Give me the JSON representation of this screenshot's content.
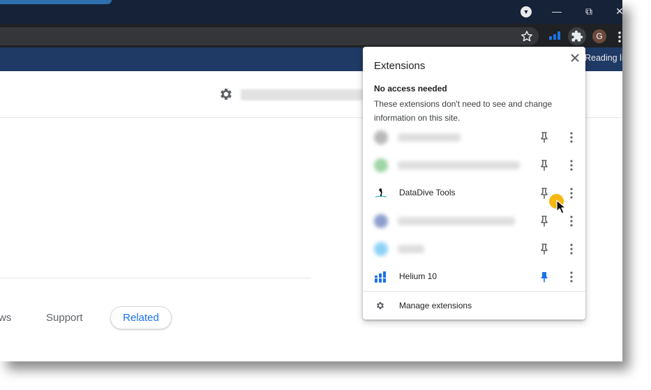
{
  "colors": {
    "titlebar": "#152238",
    "toolbar": "#202124",
    "bookmarks_bar": "#1f3a64",
    "accent_blue": "#1a73e8",
    "cursor_highlight": "#f4b400"
  },
  "window": {
    "minimize_glyph": "—",
    "maximize_glyph": "⧉",
    "close_glyph": "✕",
    "tab_search_icon": "chevron-down-icon"
  },
  "toolbar": {
    "bookmark_icon": "star-icon",
    "extensions_icon": "puzzle-icon",
    "avatar_letter": "G",
    "menu_icon": "kebab-icon"
  },
  "bookmarks": {
    "reading_list_label": "Reading lis"
  },
  "page": {
    "settings_icon": "gear-icon",
    "nav_partial_label": "ws",
    "nav_support_label": "Support",
    "nav_related_label": "Related"
  },
  "extensions_popup": {
    "title": "Extensions",
    "close_icon": "close-icon",
    "section_heading": "No access needed",
    "section_description": "These extensions don't need to see and change information on this site.",
    "items": [
      {
        "name": "",
        "blurred": true,
        "pinned": false
      },
      {
        "name": "",
        "blurred": true,
        "pinned": false
      },
      {
        "name": "DataDive Tools",
        "blurred": false,
        "pinned": false
      },
      {
        "name": "",
        "blurred": true,
        "pinned": false
      },
      {
        "name": "",
        "blurred": true,
        "pinned": false
      },
      {
        "name": "Helium 10",
        "blurred": false,
        "pinned": true
      }
    ],
    "manage_label": "Manage extensions"
  }
}
